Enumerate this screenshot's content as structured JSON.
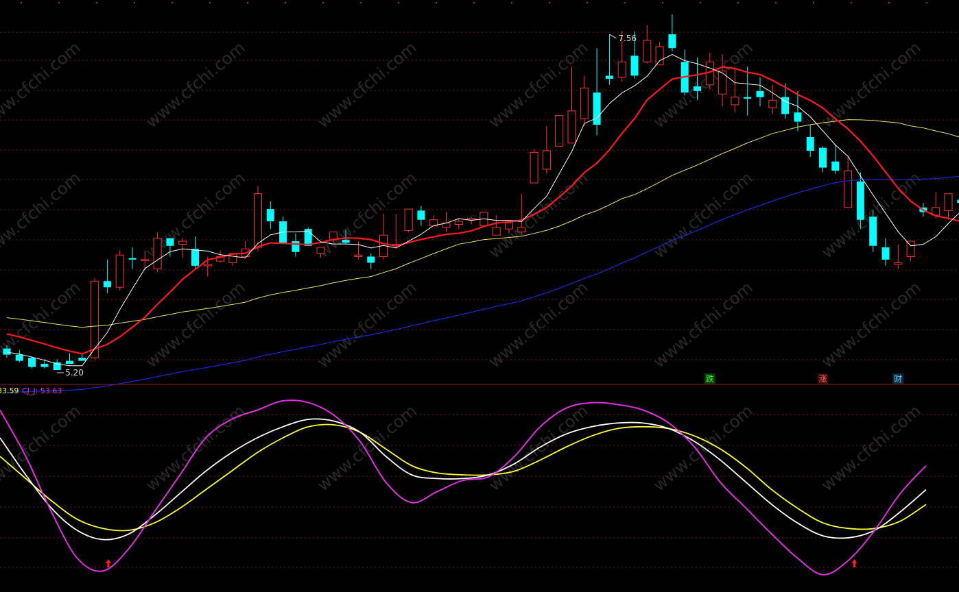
{
  "colors": {
    "background": "#000000",
    "up": "#ff3232",
    "down": "#00ffff",
    "gridline": "#7a1a1a",
    "ma_white": "#ffffff",
    "ma_red": "#ff1a1a",
    "ma_yellow": "#e8e85a",
    "ma_blue": "#1a2ad8",
    "kdj_k": "#ffffff",
    "kdj_d": "#ffff33",
    "kdj_j": "#e030e0",
    "arrow": "#ff2020",
    "divider": "#a01a1a",
    "watermark": "#4a4a4a"
  },
  "watermark": "www.cfchi.com",
  "indicator_labels": {
    "d_label": "33.59",
    "j_label": "CJ_J: 53.63"
  },
  "markers": [
    {
      "label": "跌",
      "index": 56,
      "color": "#33ff33",
      "bg": "#0b3a0b"
    },
    {
      "label": "涨",
      "index": 65,
      "color": "#ff6666",
      "bg": "#3a0b0b"
    },
    {
      "label": "财",
      "index": 71,
      "color": "#66ccff",
      "bg": "#0b2a3a"
    }
  ],
  "chart_data": [
    {
      "type": "candlestick",
      "ylim": [
        5.2,
        7.56
      ],
      "high_label": "7.56",
      "low_label": "5.20",
      "high_index": 48,
      "low_index": 4,
      "ohlc": [
        [
          5.34,
          5.36,
          5.3,
          5.28
        ],
        [
          5.3,
          5.33,
          5.26,
          5.25
        ],
        [
          5.28,
          5.29,
          5.22,
          5.21
        ],
        [
          5.24,
          5.27,
          5.22,
          5.21
        ],
        [
          5.25,
          5.27,
          5.2,
          5.2
        ],
        [
          5.26,
          5.31,
          5.24,
          5.24
        ],
        [
          5.28,
          5.31,
          5.26,
          5.26
        ],
        [
          5.28,
          5.8,
          5.78,
          5.27
        ],
        [
          5.78,
          5.92,
          5.74,
          5.7
        ],
        [
          5.74,
          5.98,
          5.95,
          5.72
        ],
        [
          5.93,
          6.0,
          5.92,
          5.86
        ],
        [
          5.92,
          5.98,
          5.92,
          5.85
        ],
        [
          5.86,
          6.1,
          6.06,
          5.84
        ],
        [
          6.06,
          6.06,
          6.01,
          5.94
        ],
        [
          6.02,
          6.06,
          6.04,
          5.93
        ],
        [
          5.99,
          6.07,
          5.88,
          5.86
        ],
        [
          5.88,
          5.94,
          5.89,
          5.81
        ],
        [
          5.91,
          5.98,
          5.94,
          5.9
        ],
        [
          5.9,
          5.96,
          5.96,
          5.88
        ],
        [
          5.94,
          6.04,
          5.99,
          5.93
        ],
        [
          6.0,
          6.4,
          6.35,
          5.98
        ],
        [
          6.25,
          6.3,
          6.17,
          6.12
        ],
        [
          6.17,
          6.2,
          6.03,
          6.02
        ],
        [
          6.04,
          6.09,
          5.97,
          5.94
        ],
        [
          6.12,
          6.13,
          6.01,
          6.02
        ],
        [
          5.96,
          6.0,
          6.0,
          5.93
        ],
        [
          6.05,
          6.08,
          6.1,
          6.03
        ],
        [
          6.05,
          6.12,
          6.03,
          6.02
        ],
        [
          5.94,
          6.04,
          5.95,
          5.92
        ],
        [
          5.94,
          5.96,
          5.9,
          5.86
        ],
        [
          5.94,
          6.22,
          6.08,
          5.92
        ],
        [
          6.02,
          6.22,
          6.02,
          6.0
        ],
        [
          6.11,
          6.2,
          6.25,
          6.1
        ],
        [
          6.24,
          6.27,
          6.18,
          6.14
        ],
        [
          6.14,
          6.21,
          6.18,
          6.14
        ],
        [
          6.13,
          6.23,
          6.16,
          6.1
        ],
        [
          6.15,
          6.19,
          6.17,
          6.12
        ],
        [
          6.18,
          6.2,
          6.19,
          6.15
        ],
        [
          6.14,
          6.23,
          6.23,
          6.13
        ],
        [
          6.08,
          6.21,
          6.13,
          6.11
        ],
        [
          6.12,
          6.15,
          6.16,
          6.09
        ],
        [
          6.1,
          6.35,
          6.13,
          6.09
        ],
        [
          6.42,
          6.64,
          6.62,
          6.42
        ],
        [
          6.51,
          6.79,
          6.63,
          6.48
        ],
        [
          6.66,
          6.8,
          6.86,
          6.66
        ],
        [
          6.68,
          7.18,
          6.89,
          6.69
        ],
        [
          6.84,
          7.12,
          7.04,
          6.79
        ],
        [
          7.01,
          7.3,
          6.8,
          6.73
        ],
        [
          7.12,
          7.39,
          7.1,
          7.06
        ],
        [
          7.11,
          7.41,
          7.21,
          7.08
        ],
        [
          7.25,
          7.41,
          7.12,
          7.1
        ],
        [
          7.21,
          7.45,
          7.35,
          7.2
        ],
        [
          7.19,
          7.34,
          7.31,
          7.19
        ],
        [
          7.39,
          7.52,
          7.3,
          7.28
        ],
        [
          7.21,
          7.29,
          7.01,
          6.99
        ],
        [
          7.05,
          7.24,
          7.02,
          6.96
        ],
        [
          7.06,
          7.27,
          7.21,
          7.03
        ],
        [
          7.0,
          7.26,
          7.15,
          6.92
        ],
        [
          6.93,
          7.18,
          6.98,
          6.88
        ],
        [
          6.98,
          7.18,
          6.97,
          6.86
        ],
        [
          7.02,
          7.11,
          6.98,
          6.92
        ],
        [
          6.91,
          7.06,
          6.96,
          6.87
        ],
        [
          6.98,
          7.07,
          6.87,
          6.84
        ],
        [
          6.88,
          7.02,
          6.82,
          6.76
        ],
        [
          6.72,
          6.8,
          6.63,
          6.59
        ],
        [
          6.65,
          6.66,
          6.52,
          6.49
        ],
        [
          6.56,
          6.67,
          6.5,
          6.48
        ],
        [
          6.26,
          6.59,
          6.5,
          6.26
        ],
        [
          6.43,
          6.49,
          6.18,
          6.12
        ],
        [
          6.2,
          6.24,
          6.01,
          5.97
        ],
        [
          6.0,
          6.06,
          5.92,
          5.88
        ],
        [
          5.89,
          6.02,
          5.9,
          5.86
        ],
        [
          5.94,
          6.01,
          6.04,
          5.91
        ],
        [
          6.26,
          6.29,
          6.23,
          6.2
        ],
        [
          6.21,
          6.36,
          6.26,
          6.19
        ],
        [
          6.24,
          6.34,
          6.35,
          6.18
        ],
        [
          6.31,
          6.35,
          6.29,
          6.27
        ]
      ]
    },
    {
      "type": "line",
      "ylim": [
        0,
        100
      ],
      "series": [
        {
          "name": "",
          "key": "k",
          "values": [
            80,
            60,
            42,
            30,
            25,
            28,
            38,
            50,
            62,
            72,
            80,
            86,
            90,
            89,
            83,
            70,
            60,
            58,
            58,
            60,
            66,
            75,
            82,
            86,
            88,
            88,
            85,
            78,
            68,
            56,
            44,
            34,
            27,
            26,
            30,
            40,
            52
          ]
        },
        {
          "name": "",
          "key": "d",
          "values": [
            70,
            58,
            46,
            36,
            31,
            30,
            34,
            42,
            52,
            62,
            72,
            80,
            86,
            87,
            83,
            74,
            65,
            61,
            60,
            60,
            62,
            68,
            75,
            81,
            85,
            86,
            85,
            81,
            74,
            64,
            52,
            42,
            34,
            31,
            31,
            35,
            44
          ]
        },
        {
          "name": "",
          "key": "j",
          "values": [
            95,
            70,
            40,
            15,
            8,
            20,
            40,
            60,
            80,
            90,
            95,
            100,
            99,
            92,
            78,
            56,
            45,
            51,
            57,
            59,
            70,
            86,
            96,
            99,
            98,
            95,
            88,
            75,
            56,
            42,
            28,
            15,
            6,
            14,
            30,
            50,
            65
          ]
        }
      ],
      "crosses": [
        4,
        33
      ]
    }
  ]
}
